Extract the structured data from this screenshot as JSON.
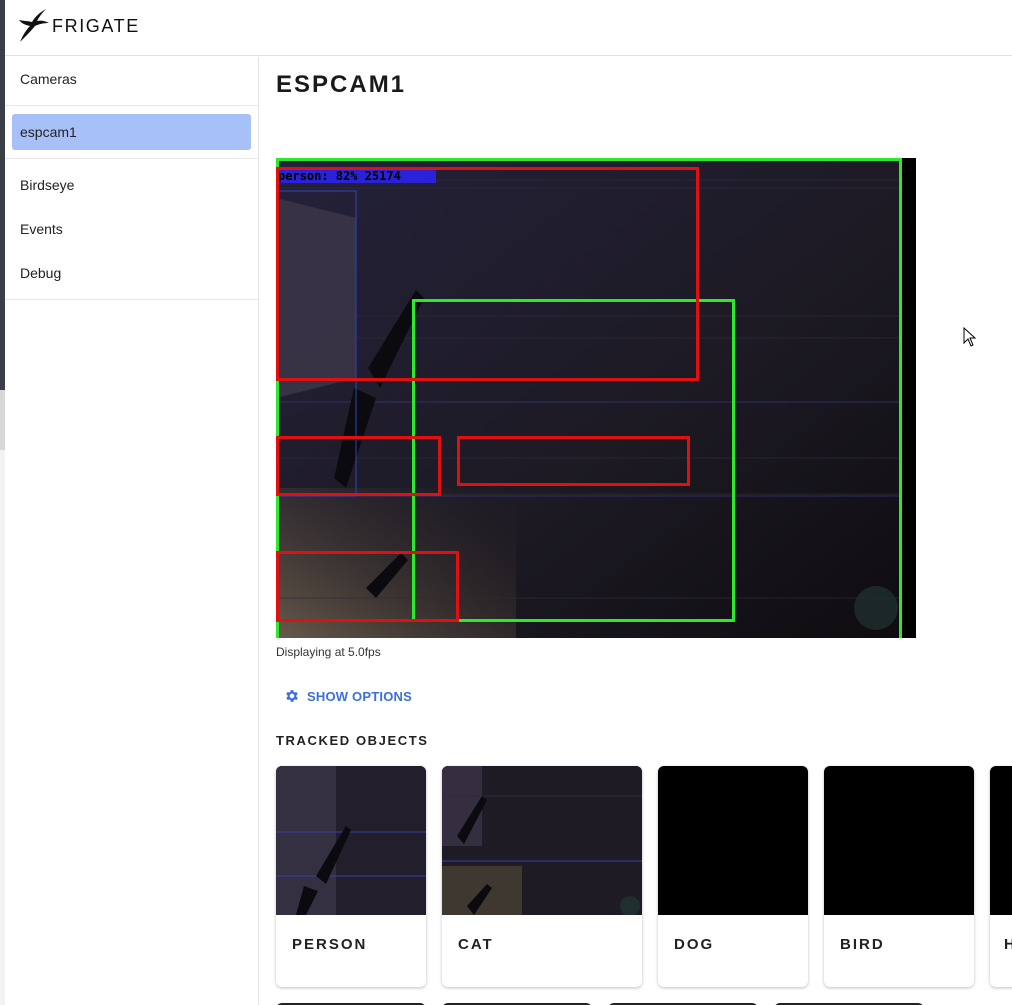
{
  "app": {
    "brand": "FRIGATE"
  },
  "sidebar": {
    "items": [
      {
        "label": "Cameras"
      },
      {
        "label": "espcam1",
        "active": true
      },
      {
        "label": "Birdseye"
      },
      {
        "label": "Events"
      },
      {
        "label": "Debug"
      }
    ]
  },
  "main": {
    "title": "ESPCAM1",
    "feed": {
      "overlay_label": "person: 82% 25174"
    },
    "fps_text": "Displaying at 5.0fps",
    "options_button": "SHOW OPTIONS",
    "tracked_title": "TRACKED OBJECTS",
    "tracked_objects": [
      {
        "label": "PERSON",
        "icon": "person-snapshot"
      },
      {
        "label": "CAT",
        "icon": "cat-snapshot"
      },
      {
        "label": "DOG",
        "icon": "dog-snapshot"
      },
      {
        "label": "BIRD",
        "icon": "bird-snapshot"
      },
      {
        "label": "H",
        "icon": "partial-snapshot"
      }
    ]
  },
  "colors": {
    "accent": "#3b6fe0",
    "active_nav": "#a8c0f8",
    "motion_box": "#2ee82e",
    "detection_box": "#e01010",
    "label_bg": "#2a22d8"
  }
}
